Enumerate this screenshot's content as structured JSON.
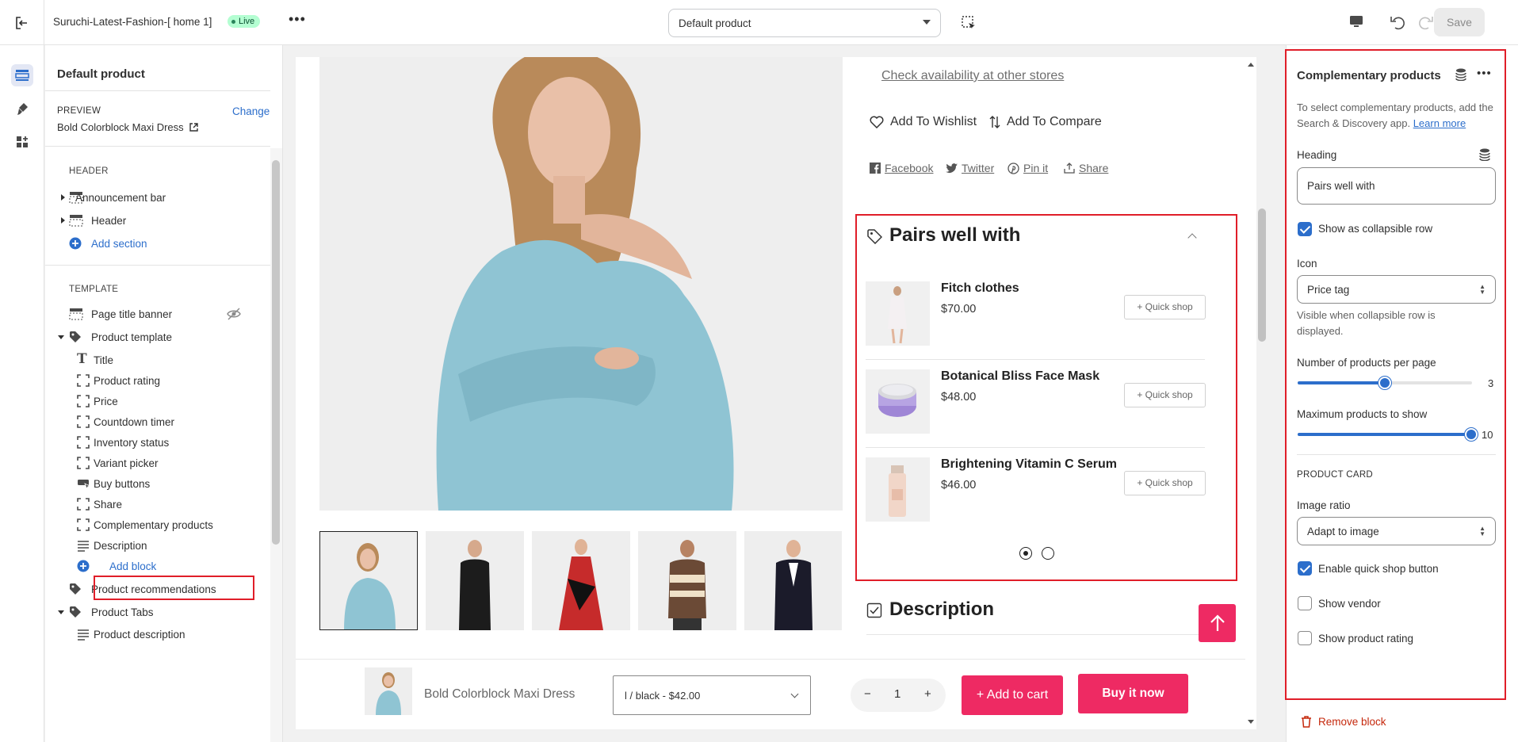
{
  "topbar": {
    "theme_name": "Suruchi-Latest-Fashion-[ home 1]",
    "live_badge": "Live",
    "more": "•••",
    "template_select": "Default product",
    "save": "Save"
  },
  "sidebar": {
    "title": "Default product",
    "preview_label": "PREVIEW",
    "preview_value": "Bold Colorblock Maxi Dress",
    "change": "Change",
    "header_label": "HEADER",
    "header_items": [
      "Announcement bar",
      "Header"
    ],
    "add_section": "Add section",
    "template_label": "TEMPLATE",
    "page_title_banner": "Page title banner",
    "product_template": "Product template",
    "blocks": [
      "Title",
      "Product rating",
      "Price",
      "Countdown timer",
      "Inventory status",
      "Variant picker",
      "Buy buttons",
      "Share",
      "Complementary products",
      "Description"
    ],
    "add_block": "Add block",
    "product_recommendations": "Product recommendations",
    "product_tabs": "Product Tabs",
    "product_description": "Product description"
  },
  "preview": {
    "check_availability": "Check availability at other stores",
    "wishlist": "Add To Wishlist",
    "compare": "Add To Compare",
    "social": [
      "Facebook",
      "Twitter",
      "Pin it",
      "Share"
    ],
    "pairs_heading": "Pairs well with",
    "products": [
      {
        "name": "Fitch clothes",
        "price": "$70.00",
        "button": "+ Quick shop"
      },
      {
        "name": "Botanical Bliss Face Mask",
        "price": "$48.00",
        "button": "+ Quick shop"
      },
      {
        "name": "Brightening Vitamin C Serum",
        "price": "$46.00",
        "button": "+ Quick shop"
      }
    ],
    "description_heading": "Description",
    "sticky": {
      "name": "Bold Colorblock Maxi Dress",
      "variant": "l / black - $42.00",
      "qty_minus": "−",
      "qty": "1",
      "qty_plus": "+",
      "add_to_cart": "+ Add to cart",
      "buy_now": "Buy it now"
    }
  },
  "settings": {
    "title": "Complementary products",
    "help": "To select complementary products, add the Search & Discovery app.",
    "help_link": "Learn more",
    "heading_label": "Heading",
    "heading_value": "Pairs well with",
    "show_collapsible": "Show as collapsible row",
    "icon_label": "Icon",
    "icon_value": "Price tag",
    "icon_help": "Visible when collapsible row is displayed.",
    "per_page_label": "Number of products per page",
    "per_page_value": "3",
    "per_page_fraction": 0.5,
    "max_label": "Maximum products to show",
    "max_value": "10",
    "max_fraction": 1.0,
    "product_card_label": "PRODUCT CARD",
    "image_ratio_label": "Image ratio",
    "image_ratio_value": "Adapt to image",
    "enable_quick_shop": "Enable quick shop button",
    "show_vendor": "Show vendor",
    "show_rating": "Show product rating",
    "remove_block": "Remove block"
  },
  "colors": {
    "accent": "#2c6ecb",
    "brand_pink": "#ee2a63",
    "highlight_red": "#e01e29",
    "sweater_blue": "#8fc4d3"
  }
}
